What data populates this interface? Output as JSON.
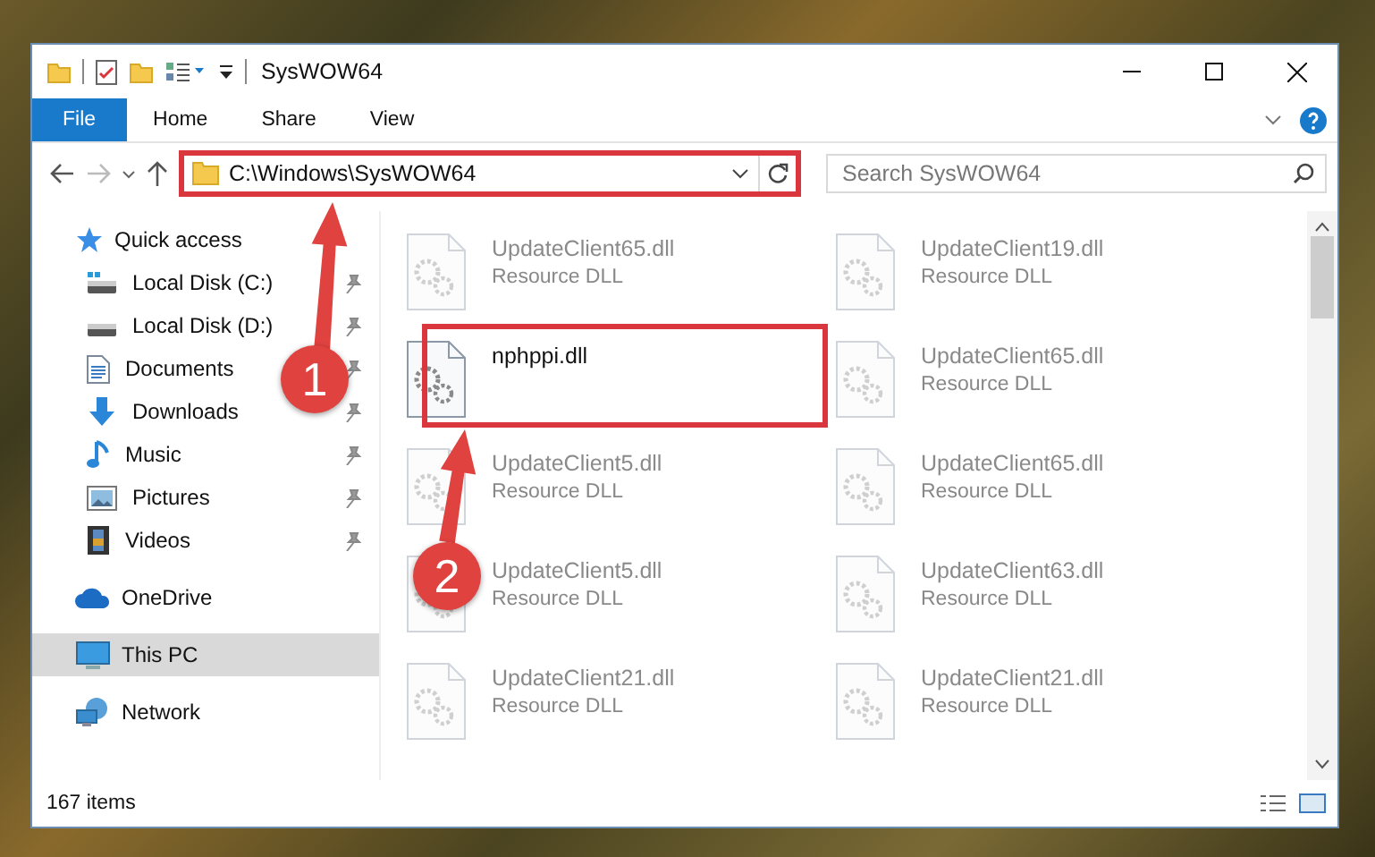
{
  "window": {
    "title": "SysWOW64"
  },
  "ribbon": {
    "tabs": [
      {
        "label": "File",
        "kind": "file-menu"
      },
      {
        "label": "Home",
        "kind": "tab"
      },
      {
        "label": "Share",
        "kind": "tab"
      },
      {
        "label": "View",
        "kind": "tab"
      }
    ]
  },
  "address_bar": {
    "path": "C:\\Windows\\SysWOW64"
  },
  "search": {
    "placeholder": "Search SysWOW64"
  },
  "navigation": {
    "items": [
      {
        "label": "Quick access",
        "kind": "star",
        "selected": false,
        "children": [
          {
            "label": "Local Disk (C:)",
            "kind": "system-drive",
            "pinned": true
          },
          {
            "label": "Local Disk (D:)",
            "kind": "drive",
            "pinned": true
          },
          {
            "label": "Documents",
            "kind": "documents",
            "pinned": true
          },
          {
            "label": "Downloads",
            "kind": "downloads",
            "pinned": true
          },
          {
            "label": "Music",
            "kind": "music",
            "pinned": true
          },
          {
            "label": "Pictures",
            "kind": "pictures",
            "pinned": true
          },
          {
            "label": "Videos",
            "kind": "videos",
            "pinned": true
          }
        ]
      },
      {
        "label": "OneDrive",
        "kind": "cloud",
        "selected": false
      },
      {
        "label": "This PC",
        "kind": "computer",
        "selected": true
      },
      {
        "label": "Network",
        "kind": "network",
        "selected": false
      }
    ]
  },
  "files": [
    {
      "name": "UpdateClient65.dll",
      "type": "Resource DLL",
      "blurred": true
    },
    {
      "name": "UpdateClient19.dll",
      "type": "Resource DLL",
      "blurred": true
    },
    {
      "name": "nphppi.dll",
      "blurred": false
    },
    {
      "name": "UpdateClient65.dll",
      "type": "Resource DLL",
      "blurred": true
    },
    {
      "name": "UpdateClient5.dll",
      "type": "Resource DLL",
      "blurred": true
    },
    {
      "name": "UpdateClient65.dll",
      "type": "Resource DLL",
      "blurred": true
    },
    {
      "name": "UpdateClient5.dll",
      "type": "Resource DLL",
      "blurred": true
    },
    {
      "name": "UpdateClient63.dll",
      "type": "Resource DLL",
      "blurred": true
    },
    {
      "name": "UpdateClient21.dll",
      "type": "Resource DLL",
      "blurred": true
    },
    {
      "name": "UpdateClient21.dll",
      "type": "Resource DLL",
      "blurred": true
    }
  ],
  "callouts": [
    {
      "number": "1"
    },
    {
      "number": "2"
    }
  ],
  "status_bar": {
    "item_count": "167 items"
  }
}
